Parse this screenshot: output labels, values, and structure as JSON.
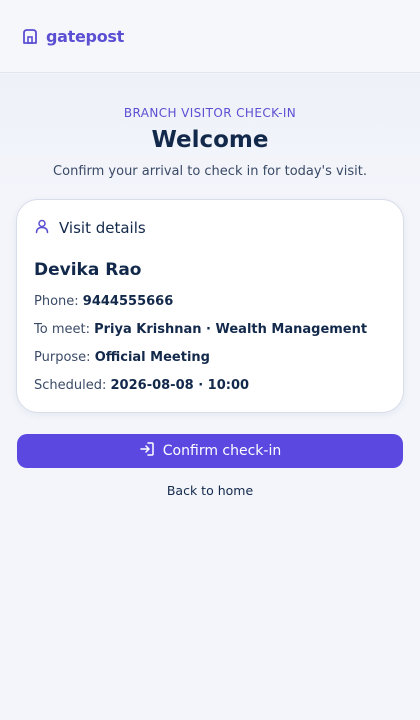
{
  "brand": {
    "name": "gatepost",
    "icon": "building-icon"
  },
  "page": {
    "eyebrow": "BRANCH VISITOR CHECK-IN",
    "title": "Welcome",
    "subtitle": "Confirm your arrival to check in for today's visit."
  },
  "card": {
    "heading": "Visit details",
    "heading_icon": "user-icon",
    "visitor_name": "Devika Rao",
    "rows": [
      {
        "label": "Phone:",
        "value": "9444555666"
      },
      {
        "label": "To meet:",
        "value": "Priya Krishnan · Wealth Management"
      },
      {
        "label": "Purpose:",
        "value": "Official Meeting"
      },
      {
        "label": "Scheduled:",
        "value": "2026-08-08 · 10:00"
      }
    ]
  },
  "actions": {
    "confirm_label": "Confirm check-in",
    "confirm_icon": "sign-in-icon",
    "back_label": "Back to home"
  },
  "colors": {
    "accent": "#5a48e0",
    "text": "#13294b",
    "background": "#f3f5fb"
  }
}
